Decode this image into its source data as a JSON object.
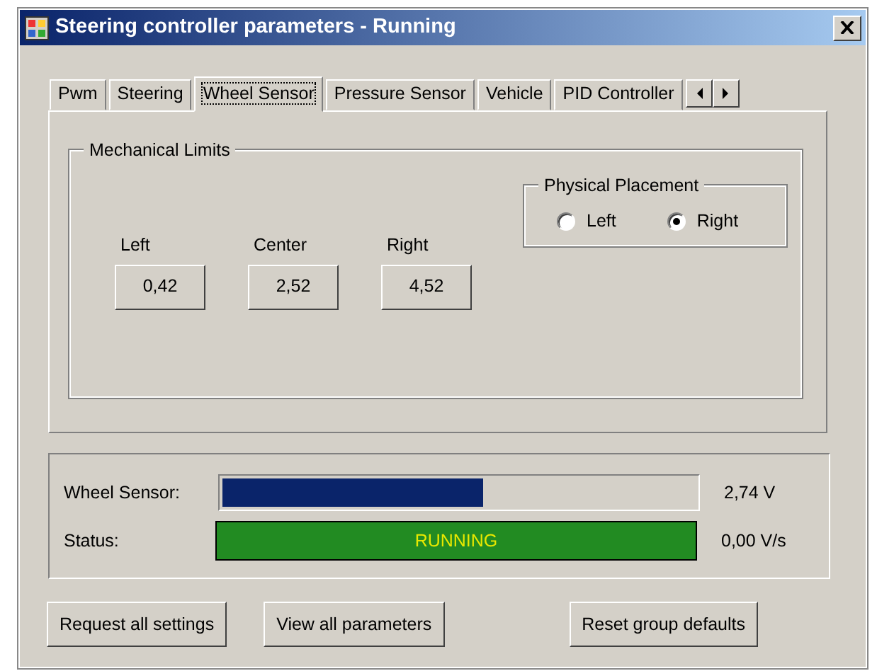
{
  "window": {
    "title": "Steering controller parameters - Running"
  },
  "tabs": [
    {
      "label": "Pwm",
      "selected": false
    },
    {
      "label": "Steering",
      "selected": false
    },
    {
      "label": "Wheel Sensor",
      "selected": true
    },
    {
      "label": "Pressure Sensor",
      "selected": false
    },
    {
      "label": "Vehicle",
      "selected": false
    },
    {
      "label": "PID Controller",
      "selected": false
    }
  ],
  "mechanical_limits": {
    "title": "Mechanical Limits",
    "limits": [
      {
        "label": "Left",
        "value": "0,42"
      },
      {
        "label": "Center",
        "value": "2,52"
      },
      {
        "label": "Right",
        "value": "4,52"
      }
    ]
  },
  "physical_placement": {
    "title": "Physical Placement",
    "options": [
      {
        "label": "Left",
        "selected": false
      },
      {
        "label": "Right",
        "selected": true
      }
    ]
  },
  "monitor": {
    "sensor_label": "Wheel Sensor:",
    "level": 0.55,
    "sensor_reading": "2,74 V",
    "status_label": "Status:",
    "status": "RUNNING",
    "rate_reading": "0,00 V/s"
  },
  "buttons": [
    "Request all settings",
    "View all parameters",
    "Reset group defaults"
  ]
}
